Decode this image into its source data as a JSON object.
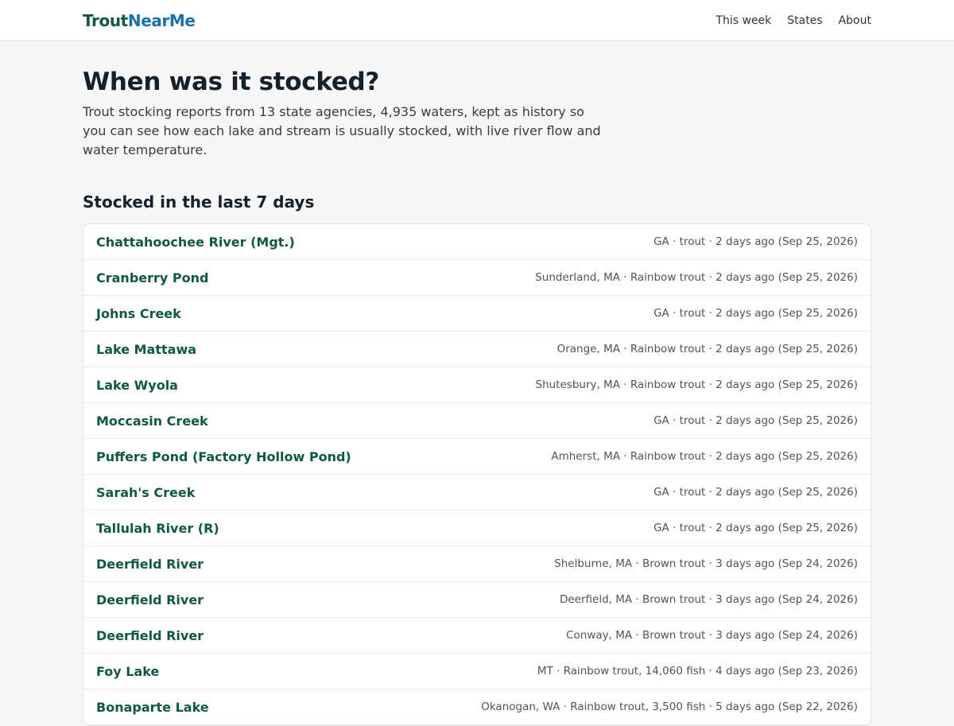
{
  "header": {
    "brand_part1": "Trout",
    "brand_part2": "NearMe",
    "nav": [
      {
        "label": "This week"
      },
      {
        "label": "States"
      },
      {
        "label": "About"
      }
    ]
  },
  "hero": {
    "title": "When was it stocked?",
    "description": "Trout stocking reports from 13 state agencies, 4,935 waters, kept as history so you can see how each lake and stream is usually stocked, with live river flow and water temperature."
  },
  "recent": {
    "heading": "Stocked in the last 7 days",
    "items": [
      {
        "name": "Chattahoochee River (Mgt.)",
        "meta": "GA · trout · 2 days ago (Sep 25, 2026)"
      },
      {
        "name": "Cranberry Pond",
        "meta": "Sunderland, MA · Rainbow trout · 2 days ago (Sep 25, 2026)"
      },
      {
        "name": "Johns Creek",
        "meta": "GA · trout · 2 days ago (Sep 25, 2026)"
      },
      {
        "name": "Lake Mattawa",
        "meta": "Orange, MA · Rainbow trout · 2 days ago (Sep 25, 2026)"
      },
      {
        "name": "Lake Wyola",
        "meta": "Shutesbury, MA · Rainbow trout · 2 days ago (Sep 25, 2026)"
      },
      {
        "name": "Moccasin Creek",
        "meta": "GA · trout · 2 days ago (Sep 25, 2026)"
      },
      {
        "name": "Puffers Pond (Factory Hollow Pond)",
        "meta": "Amherst, MA · Rainbow trout · 2 days ago (Sep 25, 2026)"
      },
      {
        "name": "Sarah's Creek",
        "meta": "GA · trout · 2 days ago (Sep 25, 2026)"
      },
      {
        "name": "Tallulah River (R)",
        "meta": "GA · trout · 2 days ago (Sep 25, 2026)"
      },
      {
        "name": "Deerfield River",
        "meta": "Shelburne, MA · Brown trout · 3 days ago (Sep 24, 2026)"
      },
      {
        "name": "Deerfield River",
        "meta": "Deerfield, MA · Brown trout · 3 days ago (Sep 24, 2026)"
      },
      {
        "name": "Deerfield River",
        "meta": "Conway, MA · Brown trout · 3 days ago (Sep 24, 2026)"
      },
      {
        "name": "Foy Lake",
        "meta": "MT · Rainbow trout, 14,060 fish · 4 days ago (Sep 23, 2026)"
      },
      {
        "name": "Bonaparte Lake",
        "meta": "Okanogan, WA · Rainbow trout, 3,500 fish · 5 days ago (Sep 22, 2026)"
      }
    ]
  },
  "colors": {
    "brand_green": "#0f5a3c",
    "brand_blue": "#1d6fa8",
    "background": "#f6f7f6"
  }
}
